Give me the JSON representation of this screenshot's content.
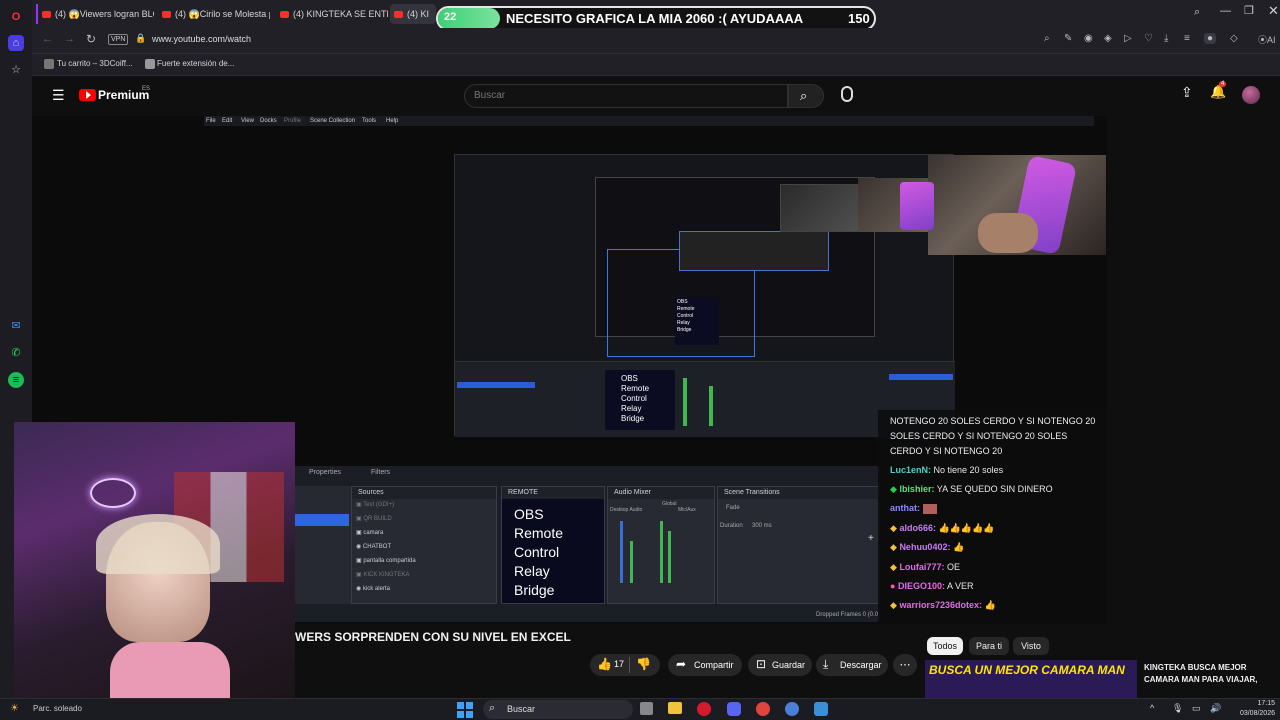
{
  "browser": {
    "tabs": [
      {
        "label": "(4) 😱Viewers logran BLO"
      },
      {
        "label": "(4) 😱Cirilo se Molesta pu"
      },
      {
        "label": "(4) KINGTEKA SE ENTERA"
      },
      {
        "label": "(4) KI"
      }
    ],
    "url": "www.youtube.com/watch",
    "vpn_label": "VPN",
    "bookmarks": [
      {
        "label": "Tu carrito – 3DCoiff..."
      },
      {
        "label": "Fuerte extensión de..."
      }
    ]
  },
  "overlay": {
    "pill_count": "22",
    "message": "NECESITO GRAFICA LA MIA 2060 :( AYUDAAAA",
    "amount": "150"
  },
  "youtube": {
    "logo_text": "Premium",
    "region": "ES",
    "search_placeholder": "Buscar",
    "notification_count": "4"
  },
  "video": {
    "menu": [
      "File",
      "Edit",
      "View",
      "Docks",
      "Profile",
      "Scene Collection",
      "Tools",
      "Help"
    ],
    "obs_text": [
      "OBS",
      "Remote",
      "Control",
      "Relay",
      "Bridge"
    ],
    "panel_tabs": [
      "Properties",
      "Filters"
    ],
    "sources_title": "Sources",
    "remote_title": "REMOTE",
    "mixer_title": "Audio Mixer",
    "transitions_title": "Scene Transitions",
    "sources": [
      "Text (GDI+)",
      "QR BUILD",
      "camara",
      "CHATBOT",
      "pantalla compartida",
      "KICK KINGTEKA",
      "kick alerta"
    ],
    "mixer_labels": [
      "Global",
      "Desktop Audio",
      "Mic/Aux"
    ],
    "transition_value": "Fade",
    "duration_label": "Duration",
    "duration_value": "300 ms",
    "dropped_frames": "Dropped Frames 0 (0.0"
  },
  "chat": [
    {
      "user": "",
      "text": "NOTENGO 20 SOLES CERDO Y SI NOTENGO 20"
    },
    {
      "user": "",
      "text": "SOLES CERDO Y SI NOTENGO 20 SOLES"
    },
    {
      "user": "",
      "text": "CERDO Y SI NOTENGO 20"
    },
    {
      "user": "Luc1enN:",
      "text": "No tiene 20 soles",
      "color": "#4fd1c5"
    },
    {
      "user": "lbishier:",
      "text": "YA SE QUEDO SIN DINERO",
      "color": "#5ee07c"
    },
    {
      "user": "anthat:",
      "text": "",
      "color": "#8b8bff"
    },
    {
      "user": "aldo666:",
      "text": "",
      "color": "#c97cf4"
    },
    {
      "user": "Nehuu0402:",
      "text": "",
      "color": "#c97cf4"
    },
    {
      "user": "Loufai777:",
      "text": "OE",
      "color": "#e36ce6"
    },
    {
      "user": "DIEGO100:",
      "text": "A VER",
      "color": "#e36ce6"
    },
    {
      "user": "warriors7236dotex:",
      "text": "",
      "color": "#e36ce6"
    }
  ],
  "video_title": "WERS SORPRENDEN CON SU NIVEL EN EXCEL",
  "actions": {
    "likes": "17",
    "share": "Compartir",
    "save": "Guardar",
    "download": "Descargar"
  },
  "chips": [
    "Todos",
    "Para ti",
    "Visto"
  ],
  "recommendation": {
    "thumb_text": "BUSCA UN MEJOR CAMARA MAN",
    "title_line1": "KINGTEKA BUSCA MEJOR",
    "title_line2": "CAMARA MAN PARA VIAJAR,"
  },
  "taskbar": {
    "weather": "Parc. soleado",
    "search": "Buscar",
    "time": "17:15",
    "date": "03/08/2026"
  }
}
